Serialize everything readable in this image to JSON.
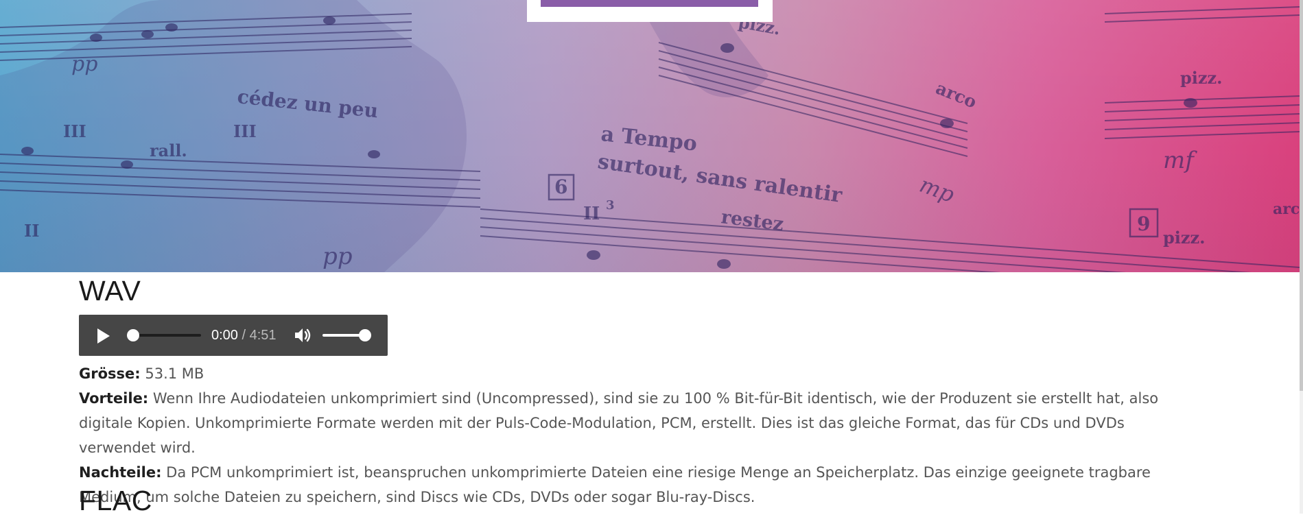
{
  "hero": {
    "score_texts": {
      "cedez": "cédez un peu",
      "rall": "rall.",
      "a_tempo": "a Tempo",
      "surtout": "surtout, sans ralentir",
      "restez": "restez",
      "arco": "arco",
      "pizz_1": "pizz.",
      "pizz_2": "pizz.",
      "pizz_3": "pizz.",
      "arc": "arc",
      "pp_1": "pp",
      "pp_2": "pp",
      "mp": "mp",
      "mf": "mf",
      "box_6": "6",
      "box_9": "9",
      "roman_iii_1": "III",
      "roman_iii_2": "III",
      "roman_ii": "II",
      "roman_ii3": "II",
      "sup_3": "3"
    }
  },
  "sections": {
    "wav": {
      "title": "WAV",
      "player": {
        "current_time": "0:00",
        "separator": " / ",
        "duration": "4:51",
        "progress": 0.0,
        "volume": 1.0
      },
      "size_label": "Grösse:",
      "size_value": " 53.1 MB",
      "pros_label": "Vorteile:",
      "pros_text": " Wenn Ihre Audiodateien unkomprimiert sind (Uncompressed), sind sie zu 100 % Bit-für-Bit identisch, wie der Produzent sie erstellt hat, also digitale Kopien. Unkomprimierte Formate werden mit der Puls-Code-Modulation, PCM, erstellt. Dies ist das gleiche Format, das für CDs und DVDs verwendet wird.",
      "cons_label": "Nachteile:",
      "cons_text": " Da PCM unkomprimiert ist, beanspruchen unkomprimierte Dateien eine riesige Menge an Speicherplatz. Das einzige geeignete tragbare Medium, um solche Dateien zu speichern, sind Discs wie CDs, DVDs oder sogar Blu-ray-Discs."
    },
    "flac": {
      "title": "FLAC"
    }
  },
  "icons": {
    "play": "play-icon",
    "volume": "volume-icon"
  },
  "colors": {
    "gradient_left": "#5aa7cf",
    "gradient_mid": "#b09bc4",
    "gradient_right": "#d9417d",
    "player_bg": "#464646",
    "tab_accent": "#8a5da8"
  }
}
